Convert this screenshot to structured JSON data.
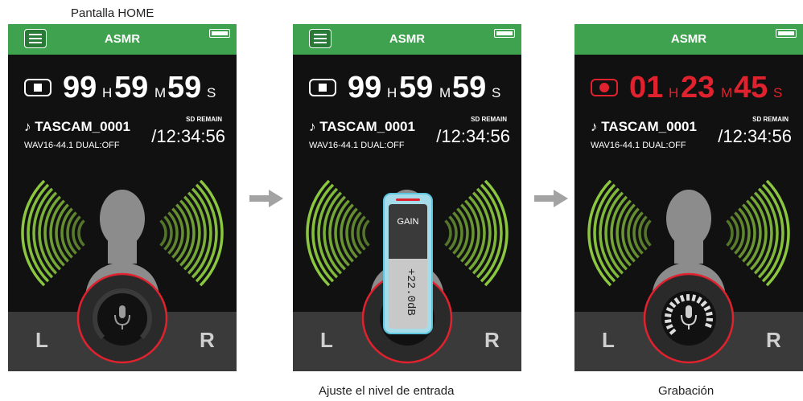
{
  "captions": {
    "home": "Pantalla HOME",
    "adjust": "Ajuste el nivel de entrada",
    "recording": "Grabación"
  },
  "colors": {
    "topbar": "#3fa24e",
    "screen_bg": "#111111",
    "record_red": "#e0222f",
    "wave_green": "#8bc83f",
    "gain_panel": "#a4dde9"
  },
  "icons": [
    "menu-icon",
    "battery-icon",
    "stop-icon",
    "record-icon",
    "note-icon",
    "person-icon",
    "mic-icon",
    "arrow-right-icon"
  ],
  "screens": [
    {
      "title": "ASMR",
      "show_menu": true,
      "state": "stop",
      "hours": "99",
      "h_unit": "H",
      "minutes": "59",
      "m_unit": "M",
      "seconds": "59",
      "s_unit": "S",
      "file": "♪ TASCAM_0001",
      "format": "WAV16-44.1 DUAL:OFF",
      "sd_label": "SD REMAIN",
      "remain": "/12:34:56",
      "left": "L",
      "right": "R"
    },
    {
      "title": "ASMR",
      "show_menu": true,
      "state": "stop",
      "hours": "99",
      "h_unit": "H",
      "minutes": "59",
      "m_unit": "M",
      "seconds": "59",
      "s_unit": "S",
      "file": "♪ TASCAM_0001",
      "format": "WAV16-44.1 DUAL:OFF",
      "sd_label": "SD REMAIN",
      "remain": "/12:34:56",
      "left": "L",
      "right": "R",
      "gain_label": "GAIN",
      "gain_value": "+22.0dB"
    },
    {
      "title": "ASMR",
      "show_menu": false,
      "state": "record",
      "hours": "01",
      "h_unit": "H",
      "minutes": "23",
      "m_unit": "M",
      "seconds": "45",
      "s_unit": "S",
      "file": "♪ TASCAM_0001",
      "format": "WAV16-44.1 DUAL:OFF",
      "sd_label": "SD REMAIN",
      "remain": "/12:34:56",
      "left": "L",
      "right": "R"
    }
  ]
}
